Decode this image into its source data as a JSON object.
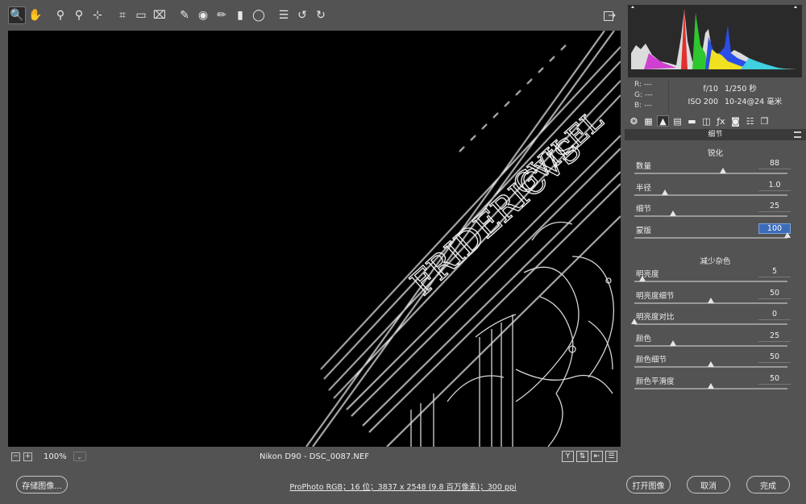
{
  "toolbar": {
    "tools": [
      {
        "icon": "zoom-icon",
        "glyph": "🔍",
        "active": true
      },
      {
        "icon": "hand-icon",
        "glyph": "✋"
      },
      {
        "icon": "white-balance-icon",
        "glyph": "⚲"
      },
      {
        "icon": "color-sampler-icon",
        "glyph": "⚲"
      },
      {
        "icon": "target-adjust-icon",
        "glyph": "⊹"
      },
      {
        "icon": "crop-icon",
        "glyph": "⌗"
      },
      {
        "icon": "straighten-icon",
        "glyph": "▭"
      },
      {
        "icon": "transform-icon",
        "glyph": "⌧"
      },
      {
        "icon": "spot-removal-icon",
        "glyph": "✎"
      },
      {
        "icon": "red-eye-icon",
        "glyph": "◉"
      },
      {
        "icon": "adjustment-brush-icon",
        "glyph": "✏"
      },
      {
        "icon": "graduated-filter-icon",
        "glyph": "▮"
      },
      {
        "icon": "radial-filter-icon",
        "glyph": "◯"
      },
      {
        "icon": "preferences-icon",
        "glyph": "☰"
      },
      {
        "icon": "rotate-left-icon",
        "glyph": "↺"
      },
      {
        "icon": "rotate-right-icon",
        "glyph": "↻"
      }
    ]
  },
  "status": {
    "zoom": "100%",
    "filename": "Nikon D90  -  DSC_0087.NEF",
    "view_buttons": [
      "Y",
      "⇅",
      "⇤",
      "☰"
    ]
  },
  "info": {
    "r": "R:   ---",
    "g": "G:   ---",
    "b": "B:   ---",
    "aperture": "f/10",
    "shutter": "1/250 秒",
    "iso": "ISO 200",
    "lens": "10-24@24 毫米"
  },
  "panel": {
    "title": "细节",
    "sharpen_title": "锐化",
    "noise_title": "减少杂色",
    "sharpen": [
      {
        "label": "数量",
        "value": "88",
        "pos": 0.58
      },
      {
        "label": "半径",
        "value": "1.0",
        "pos": 0.2
      },
      {
        "label": "细节",
        "value": "25",
        "pos": 0.25
      },
      {
        "label": "蒙版",
        "value": "100",
        "pos": 1.0,
        "highlight": true
      }
    ],
    "noise": [
      {
        "label": "明亮度",
        "value": "5",
        "pos": 0.05
      },
      {
        "label": "明亮度细节",
        "value": "50",
        "pos": 0.5
      },
      {
        "label": "明亮度对比",
        "value": "0",
        "pos": 0.0
      },
      {
        "label": "颜色",
        "value": "25",
        "pos": 0.25
      },
      {
        "label": "颜色细节",
        "value": "50",
        "pos": 0.5
      },
      {
        "label": "颜色平滑度",
        "value": "50",
        "pos": 0.5
      }
    ]
  },
  "bottom": {
    "save_label": "存储图像...",
    "workflow_label": "ProPhoto RGB；16 位；3837 x 2548 (9.8 百万像素)；300 ppi",
    "open_label": "打开图像",
    "cancel_label": "取消",
    "done_label": "完成"
  }
}
